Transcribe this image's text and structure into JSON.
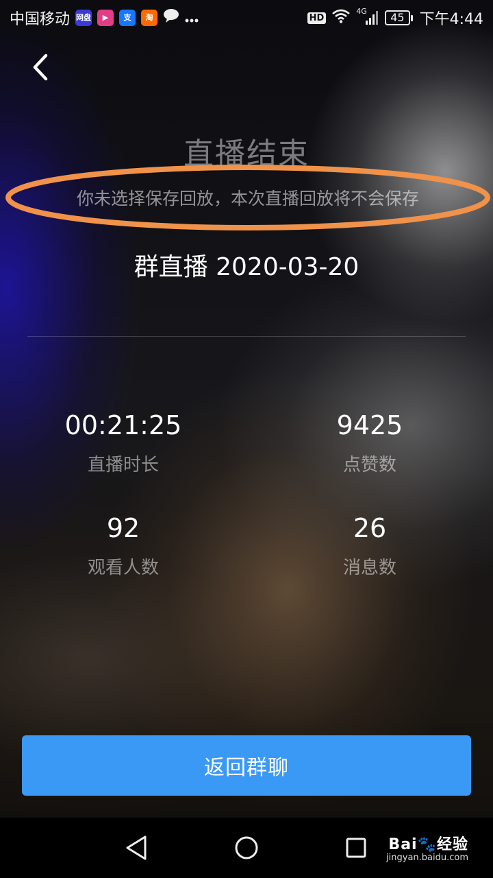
{
  "status_bar": {
    "carrier": "中国移动",
    "app_icons": [
      {
        "icon": "cloud-drive-icon",
        "text": "网盘",
        "color": "#3a3ad6"
      },
      {
        "icon": "video-app-icon",
        "text": "▶",
        "color": "#e23d87"
      },
      {
        "icon": "alipay-icon",
        "text": "支",
        "color": "#1677ff"
      },
      {
        "icon": "taobao-icon",
        "text": "淘",
        "color": "#ff6a00"
      }
    ],
    "network": "4G",
    "battery": "45",
    "time": "下午4:44"
  },
  "page": {
    "title": "直播结束",
    "notice": "你未选择保存回放，本次直播回放将不会保存",
    "session_title": "群直播 2020-03-20"
  },
  "stats": [
    {
      "value": "00:21:25",
      "label": "直播时长"
    },
    {
      "value": "9425",
      "label": "点赞数"
    },
    {
      "value": "92",
      "label": "观看人数"
    },
    {
      "value": "26",
      "label": "消息数"
    }
  ],
  "actions": {
    "return_label": "返回群聊"
  },
  "colors": {
    "accent": "#3b99f6",
    "highlight_ring": "#f0924a"
  },
  "watermark": {
    "brand": "Bai",
    "brand_suffix": "经验",
    "url": "jingyan.baidu.com"
  }
}
